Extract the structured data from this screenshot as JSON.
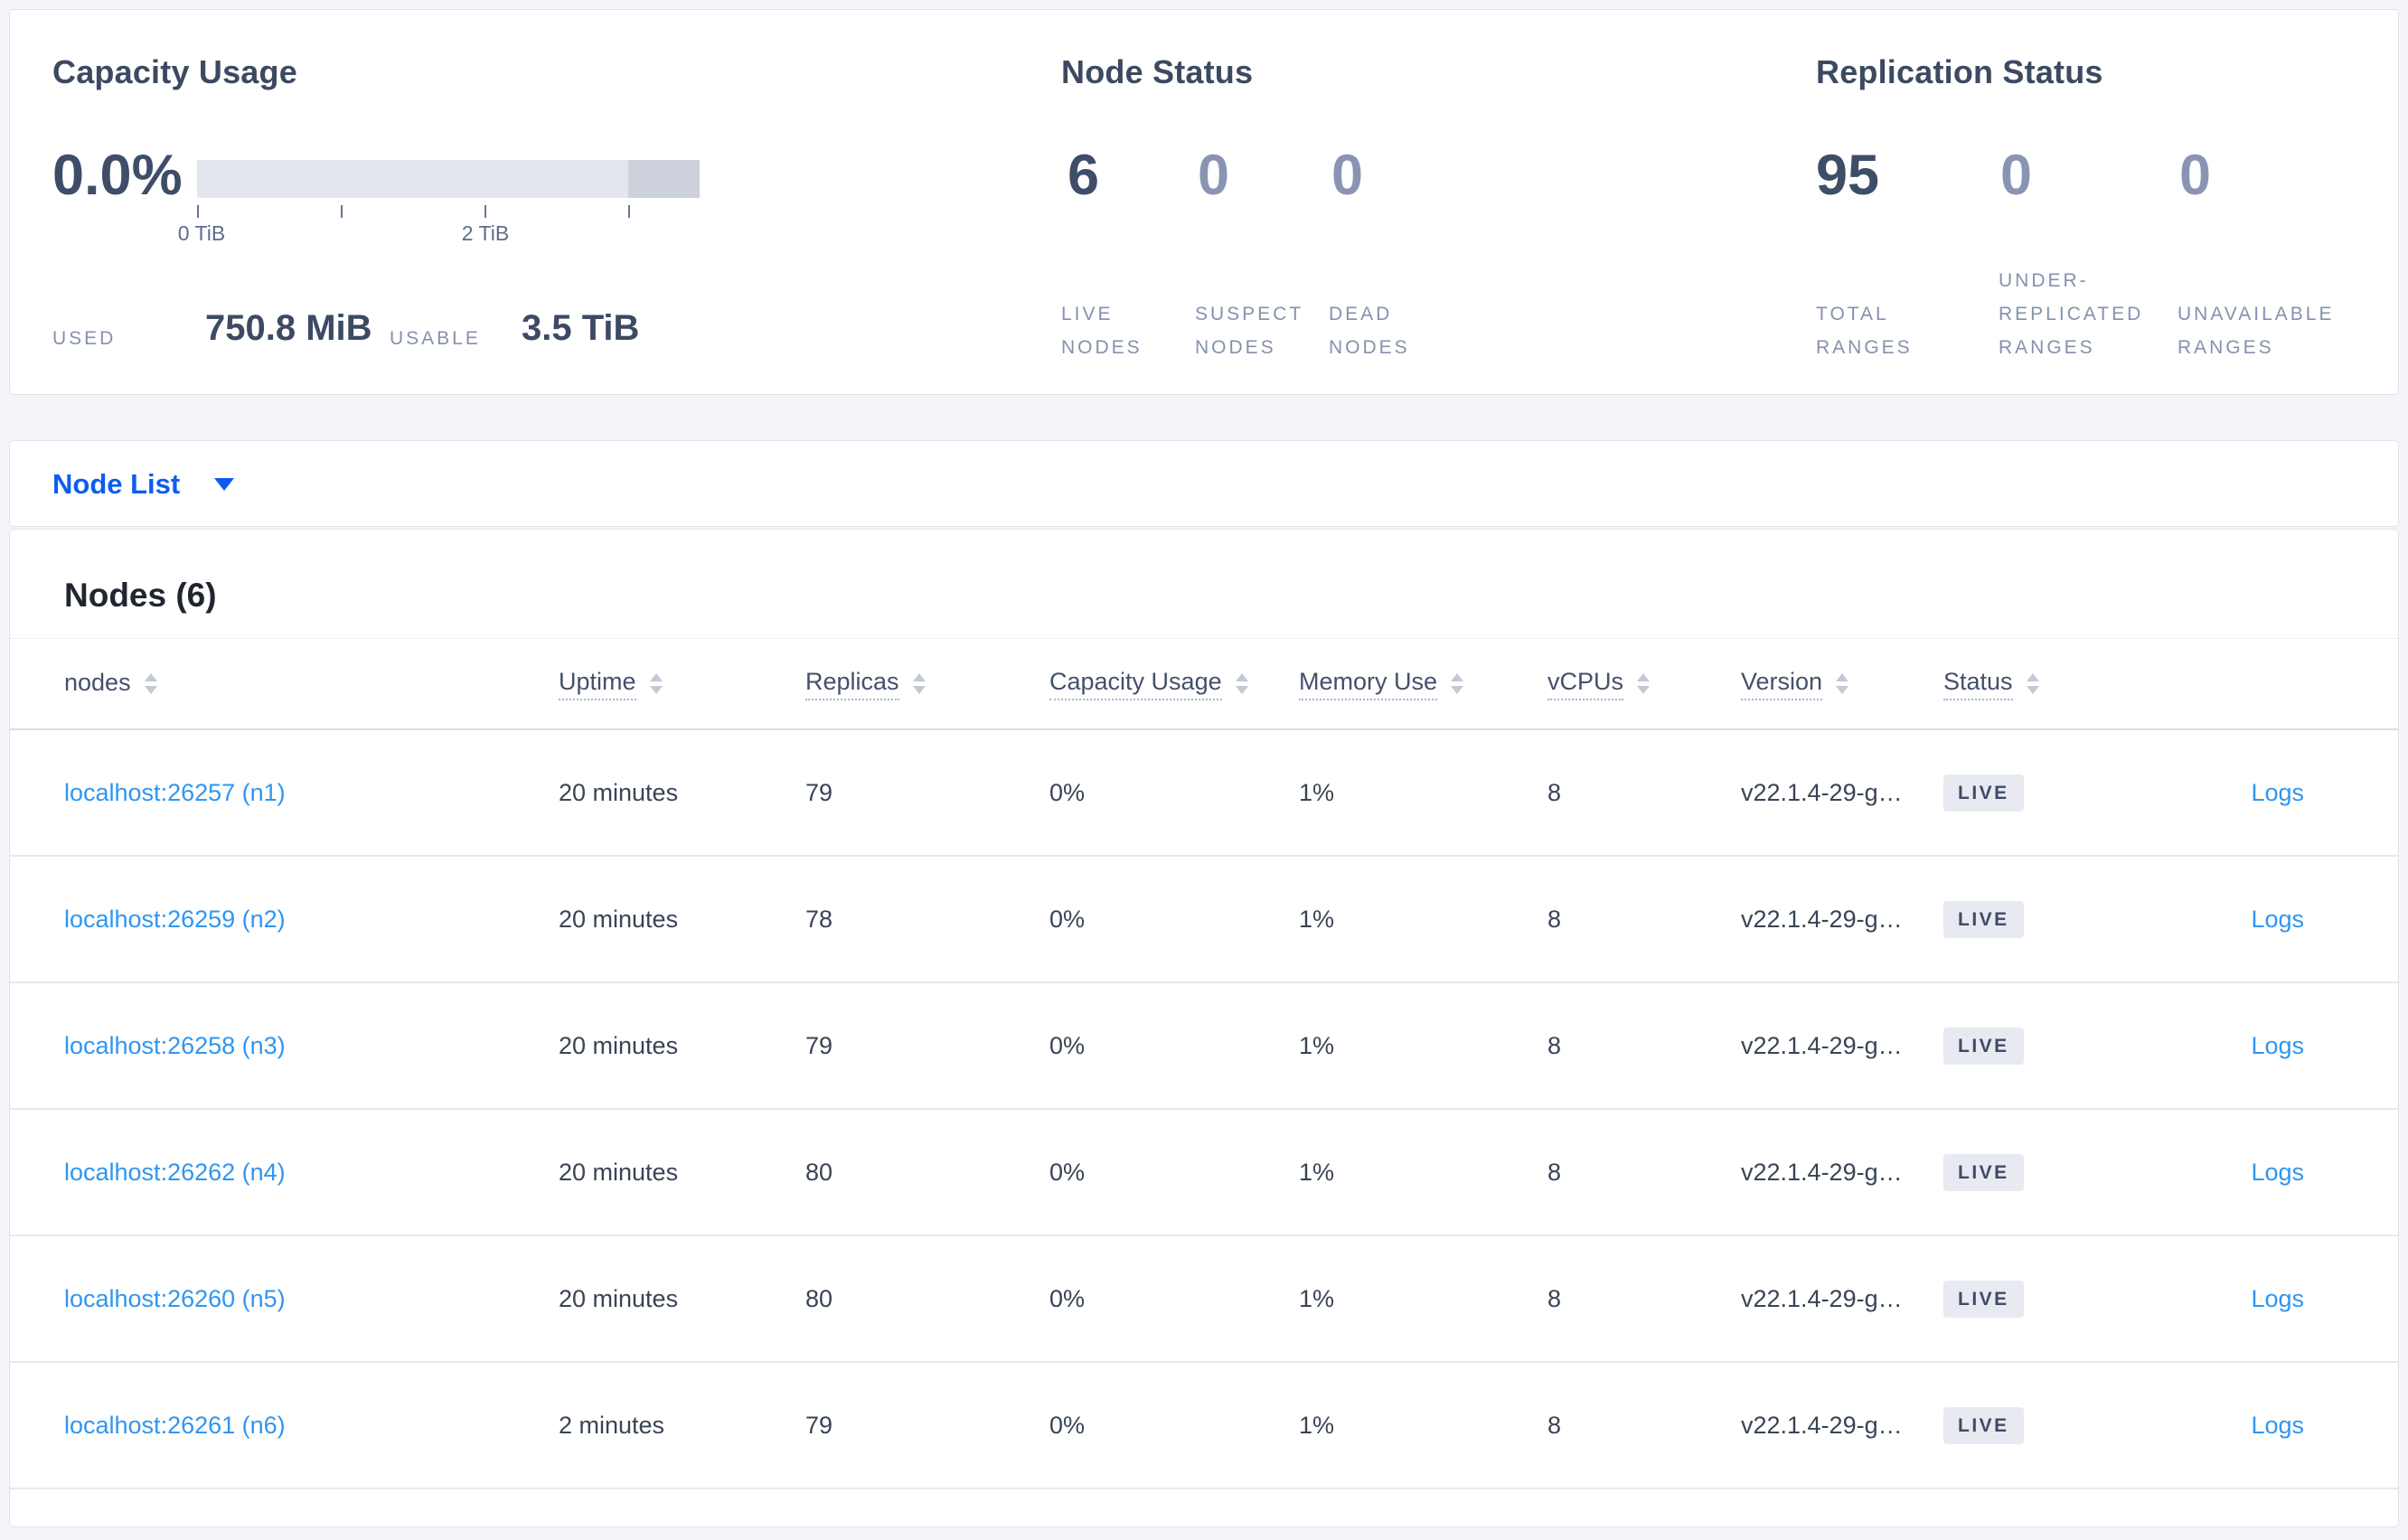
{
  "colors": {
    "accent_blue": "#0d5cf2",
    "link_blue": "#2f96f0",
    "dark_navy": "#3e4d68",
    "muted_slate": "#8591ad",
    "bar_light": "#e4e6ee",
    "bar_dark": "#cdd1db",
    "badge_bg": "#e7eaf1"
  },
  "summary": {
    "capacity_usage": {
      "title": "Capacity Usage",
      "percent": "0.0%",
      "tick_labels": [
        "0 TiB",
        "2 TiB"
      ],
      "used_label": "USED",
      "used_value": "750.8 MiB",
      "usable_label": "USABLE",
      "usable_value": "3.5 TiB"
    },
    "node_status": {
      "title": "Node Status",
      "stats": [
        {
          "value": "6",
          "lines": [
            "LIVE",
            "NODES"
          ]
        },
        {
          "value": "0",
          "lines": [
            "SUSPECT",
            "NODES"
          ]
        },
        {
          "value": "0",
          "lines": [
            "DEAD",
            "NODES"
          ]
        }
      ]
    },
    "replication_status": {
      "title": "Replication Status",
      "stats": [
        {
          "value": "95",
          "lines": [
            "TOTAL",
            "RANGES"
          ]
        },
        {
          "value": "0",
          "lines": [
            "UNDER-",
            "REPLICATED",
            "RANGES"
          ]
        },
        {
          "value": "0",
          "lines": [
            "UNAVAILABLE",
            "RANGES"
          ]
        }
      ]
    }
  },
  "node_list_dropdown": {
    "label": "Node List"
  },
  "nodes_table": {
    "title": "Nodes (6)",
    "columns": [
      "nodes",
      "Uptime",
      "Replicas",
      "Capacity Usage",
      "Memory Use",
      "vCPUs",
      "Version",
      "Status"
    ],
    "rows": [
      {
        "node": "localhost:26257 (n1)",
        "uptime": "20 minutes",
        "replicas": "79",
        "capacity_usage": "0%",
        "memory_use": "1%",
        "vcpus": "8",
        "version": "v22.1.4-29-g…",
        "status": "LIVE",
        "logs": "Logs"
      },
      {
        "node": "localhost:26259 (n2)",
        "uptime": "20 minutes",
        "replicas": "78",
        "capacity_usage": "0%",
        "memory_use": "1%",
        "vcpus": "8",
        "version": "v22.1.4-29-g…",
        "status": "LIVE",
        "logs": "Logs"
      },
      {
        "node": "localhost:26258 (n3)",
        "uptime": "20 minutes",
        "replicas": "79",
        "capacity_usage": "0%",
        "memory_use": "1%",
        "vcpus": "8",
        "version": "v22.1.4-29-g…",
        "status": "LIVE",
        "logs": "Logs"
      },
      {
        "node": "localhost:26262 (n4)",
        "uptime": "20 minutes",
        "replicas": "80",
        "capacity_usage": "0%",
        "memory_use": "1%",
        "vcpus": "8",
        "version": "v22.1.4-29-g…",
        "status": "LIVE",
        "logs": "Logs"
      },
      {
        "node": "localhost:26260 (n5)",
        "uptime": "20 minutes",
        "replicas": "80",
        "capacity_usage": "0%",
        "memory_use": "1%",
        "vcpus": "8",
        "version": "v22.1.4-29-g…",
        "status": "LIVE",
        "logs": "Logs"
      },
      {
        "node": "localhost:26261 (n6)",
        "uptime": "2 minutes",
        "replicas": "79",
        "capacity_usage": "0%",
        "memory_use": "1%",
        "vcpus": "8",
        "version": "v22.1.4-29-g…",
        "status": "LIVE",
        "logs": "Logs"
      }
    ]
  }
}
